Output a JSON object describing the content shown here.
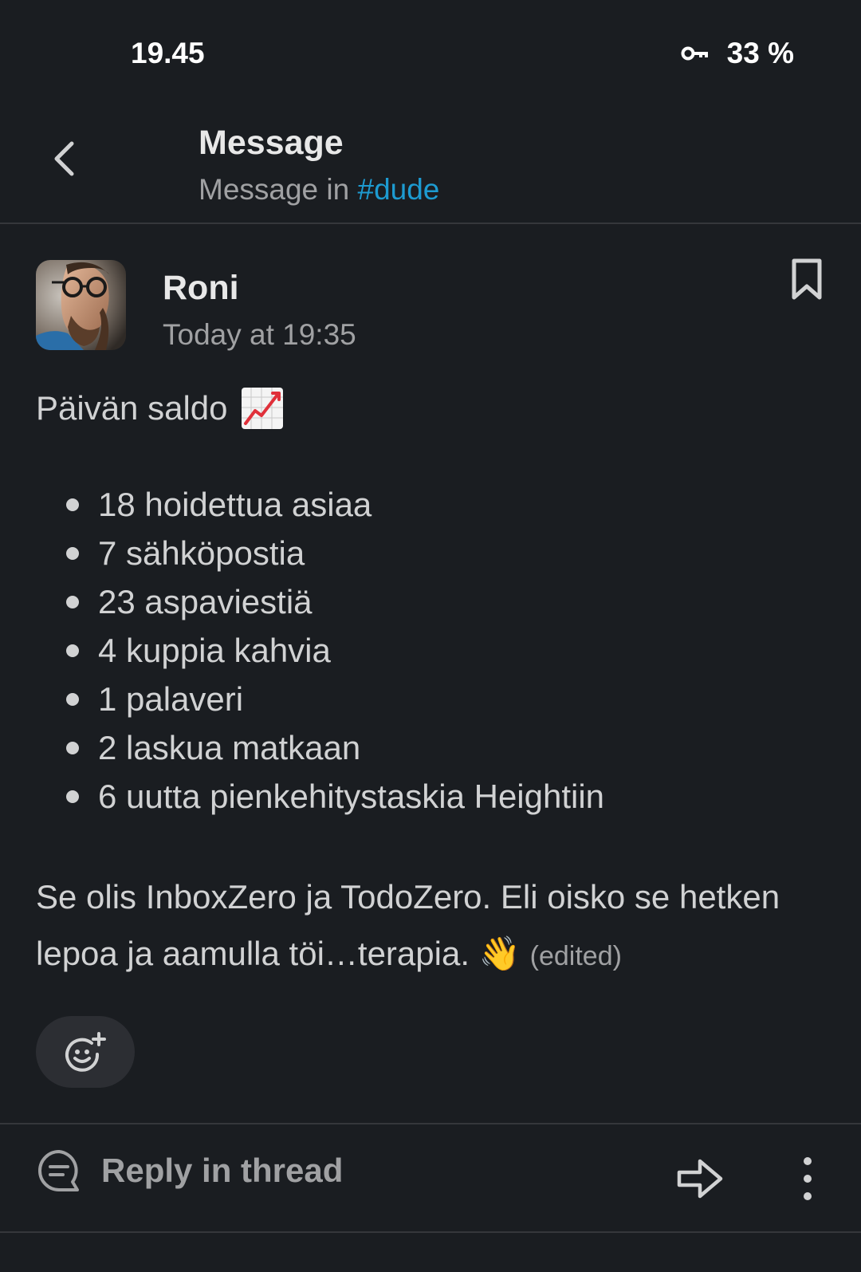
{
  "status_bar": {
    "time": "19.45",
    "battery": "33 %",
    "icons": [
      "vpn-key-icon"
    ]
  },
  "header": {
    "title": "Message",
    "subtitle_prefix": "Message in ",
    "channel": "#dude"
  },
  "message": {
    "author": "Roni",
    "timestamp": "Today at 19:35",
    "intro": "Päivän saldo",
    "intro_emoji": "chart-increasing-emoji",
    "items": [
      "18 hoidettua asiaa",
      "7 sähköpostia",
      "23 aspaviestiä",
      "4 kuppia kahvia",
      "1 palaveri",
      "2 laskua matkaan",
      "6 uutta pienkehitystaskia Heightiin"
    ],
    "outro": "Se olis InboxZero ja TodoZero. Eli oisko se hetken lepoa ja aamulla töi…terapia.",
    "outro_emoji": "👋",
    "edited": "(edited)"
  },
  "actions": {
    "reply_label": "Reply in thread"
  },
  "colors": {
    "background": "#1a1d21",
    "link": "#1d9bd1",
    "text": "#d1d2d3",
    "muted": "#a0a1a3",
    "pill": "#2c2e33"
  }
}
